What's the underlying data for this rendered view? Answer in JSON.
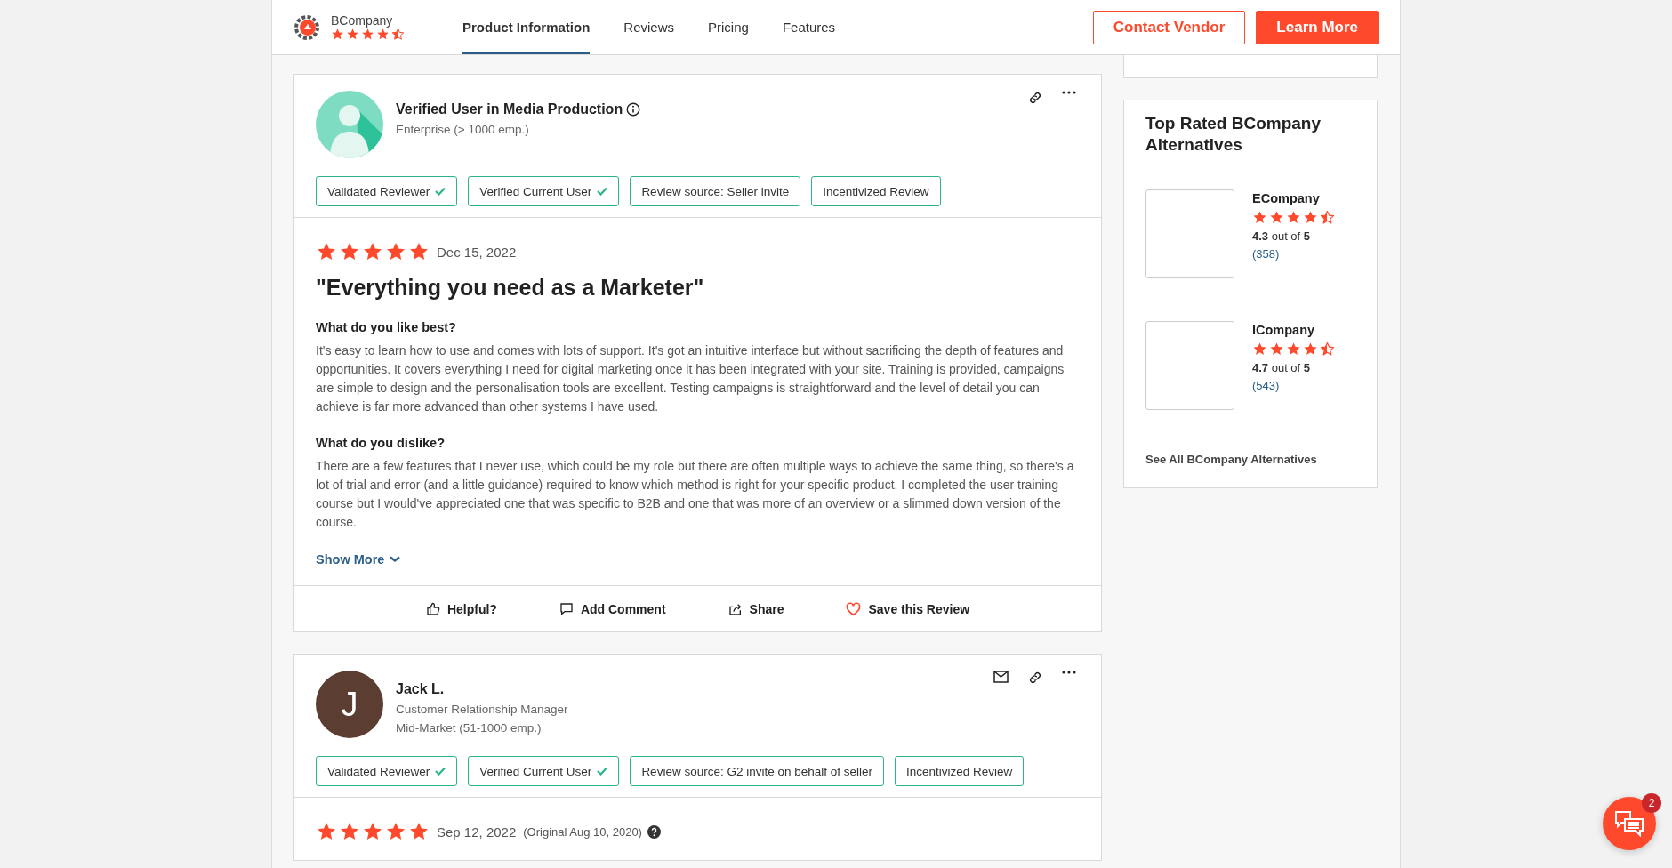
{
  "header": {
    "brand": "BCompany",
    "stars": 4.5,
    "tabs": [
      {
        "label": "Product Information",
        "selected": true
      },
      {
        "label": "Reviews",
        "selected": false
      },
      {
        "label": "Pricing",
        "selected": false
      },
      {
        "label": "Features",
        "selected": false
      }
    ],
    "buttons": [
      {
        "label": "Contact Vendor",
        "kind": "outline"
      },
      {
        "label": "Learn More",
        "kind": "filled"
      }
    ]
  },
  "reviews": [
    {
      "reviewer": {
        "name": "Verified User in Media Production",
        "info_icon": true,
        "avatar": {
          "kind": "silhouette"
        },
        "lines": [
          "Enterprise (> 1000 emp.)"
        ]
      },
      "email_action": false,
      "tags": [
        {
          "label": "Validated Reviewer",
          "verified": true
        },
        {
          "label": "Verified Current User",
          "verified": true
        },
        {
          "label": "Review source: Seller invite",
          "verified": false
        },
        {
          "label": "Incentivized Review",
          "verified": false
        }
      ],
      "stars": 5,
      "date": "Dec 15, 2022",
      "title": "\"Everything you need as a Marketer\"",
      "sections": [
        {
          "question": "What do you like best?",
          "answer": "It's easy to learn how to use and comes with lots of support. It's got an intuitive interface but without sacrificing the depth of features and opportunities. It covers everything I need for digital marketing once it has been integrated with your site. Training is provided, campaigns are simple to design and the personalisation tools are excellent. Testing campaigns is straightforward and the level of detail you can achieve is far more advanced than other systems I have used."
        },
        {
          "question": "What do you dislike?",
          "answer": "There are a few features that I never use, which could be my role but there are often multiple ways to achieve the same thing, so there's a lot of trial and error (and a little guidance) required to know which method is right for your specific product. I completed the user training course but I would've appreciated one that was specific to B2B and one that was more of an overview or a slimmed down version of the course."
        }
      ],
      "show_more": "Show More",
      "actions": [
        {
          "label": "Helpful?",
          "kind": "thumb"
        },
        {
          "label": "Add Comment",
          "kind": "comment"
        },
        {
          "label": "Share",
          "kind": "share"
        },
        {
          "label": "Save this Review",
          "kind": "heart"
        }
      ]
    },
    {
      "reviewer": {
        "name": "Jack L.",
        "info_icon": false,
        "avatar": {
          "kind": "initial",
          "letter": "J"
        },
        "lines": [
          "Customer Relationship Manager",
          "Mid-Market (51-1000 emp.)"
        ]
      },
      "email_action": true,
      "tags": [
        {
          "label": "Validated Reviewer",
          "verified": true
        },
        {
          "label": "Verified Current User",
          "verified": true
        },
        {
          "label": "Review source: G2 invite on behalf of seller",
          "verified": false
        },
        {
          "label": "Incentivized Review",
          "verified": false
        }
      ],
      "stars": 5,
      "date": "Sep 12, 2022",
      "original_date": "(Original Aug 10, 2020)"
    }
  ],
  "alternatives": {
    "title": "Top Rated BCompany Alternatives",
    "items": [
      {
        "name": "ECompany",
        "stars": 4.5,
        "rating": "**4.3** out of **5**",
        "count": "(358)"
      },
      {
        "name": "ICompany",
        "stars": 4.5,
        "rating": "**4.7** out of **5**",
        "count": "(543)"
      }
    ],
    "see_all": "See All BCompany Alternatives"
  },
  "chat": {
    "badge": "2"
  }
}
